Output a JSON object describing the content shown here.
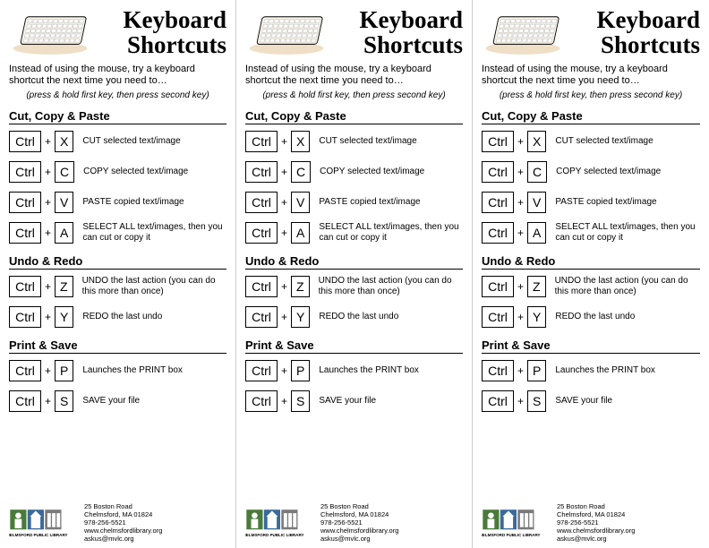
{
  "title": "Keyboard Shortcuts",
  "intro": "Instead of using the mouse, try a keyboard shortcut the next time you need to…",
  "hint": "(press & hold first key, then press second key)",
  "plus": "+",
  "sections": [
    {
      "title": "Cut, Copy & Paste",
      "items": [
        {
          "k1": "Ctrl",
          "k2": "X",
          "desc": "CUT selected text/image"
        },
        {
          "k1": "Ctrl",
          "k2": "C",
          "desc": "COPY selected text/image"
        },
        {
          "k1": "Ctrl",
          "k2": "V",
          "desc": "PASTE copied text/image"
        },
        {
          "k1": "Ctrl",
          "k2": "A",
          "desc": "SELECT ALL text/images, then you can cut or copy it"
        }
      ]
    },
    {
      "title": "Undo & Redo",
      "items": [
        {
          "k1": "Ctrl",
          "k2": "Z",
          "desc": "UNDO the last action (you can do this more than once)"
        },
        {
          "k1": "Ctrl",
          "k2": "Y",
          "desc": "REDO the last undo"
        }
      ]
    },
    {
      "title": "Print & Save",
      "items": [
        {
          "k1": "Ctrl",
          "k2": "P",
          "desc": "Launches the PRINT box"
        },
        {
          "k1": "Ctrl",
          "k2": "S",
          "desc": "SAVE your file"
        }
      ]
    }
  ],
  "contact": {
    "l1": "25 Boston Road",
    "l2": "Chelmsford, MA 01824",
    "l3": "978-256-5521",
    "l4": "www.chelmsfordlibrary.org",
    "l5": "askus@mvlc.org"
  }
}
